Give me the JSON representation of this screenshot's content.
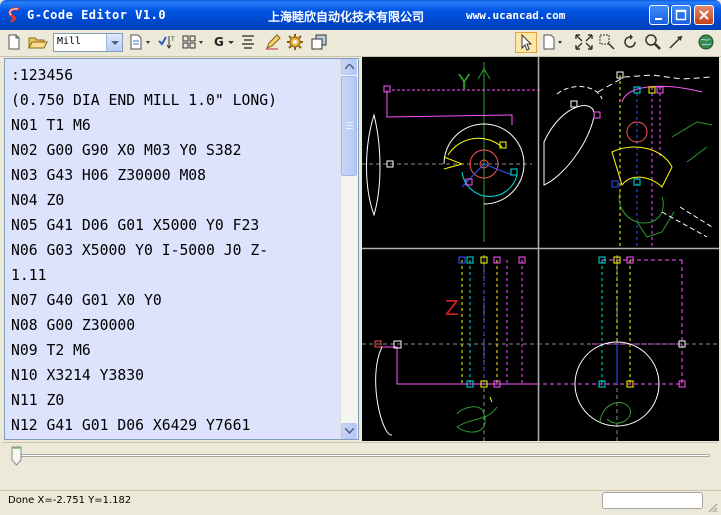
{
  "window": {
    "title": "G-Code Editor V1.0",
    "company": "上海睦欣自动化技术有限公司",
    "website": "www.ucancad.com"
  },
  "toolbar": {
    "mode_value": "Mill",
    "g_label": "G"
  },
  "editor": {
    "lines": [
      ":123456",
      "(0.750 DIA END MILL 1.0\" LONG)",
      "N01 T1 M6",
      "N02 G00 G90 X0  M03 Y0 S382",
      "N03 G43 H06 Z30000 M08",
      "N04 Z0",
      "N05 G41 D06 G01 X5000 Y0 F23",
      "N06 G03 X5000 Y0 I-5000 J0 Z-",
      "1.11",
      "N07 G40 G01 X0 Y0",
      "N08 G00 Z30000",
      "N09 T2 M6",
      "N10 X3214 Y3830",
      "N11 Z0",
      "N12 G41 G01 D06 X6429 Y7661"
    ]
  },
  "viewports": {
    "axis_labels": {
      "x": "X",
      "y": "Y",
      "z": "Z"
    }
  },
  "playback": {
    "position": 0
  },
  "status": {
    "text": "Done X=-2.751 Y=1.182",
    "progress": 0
  }
}
